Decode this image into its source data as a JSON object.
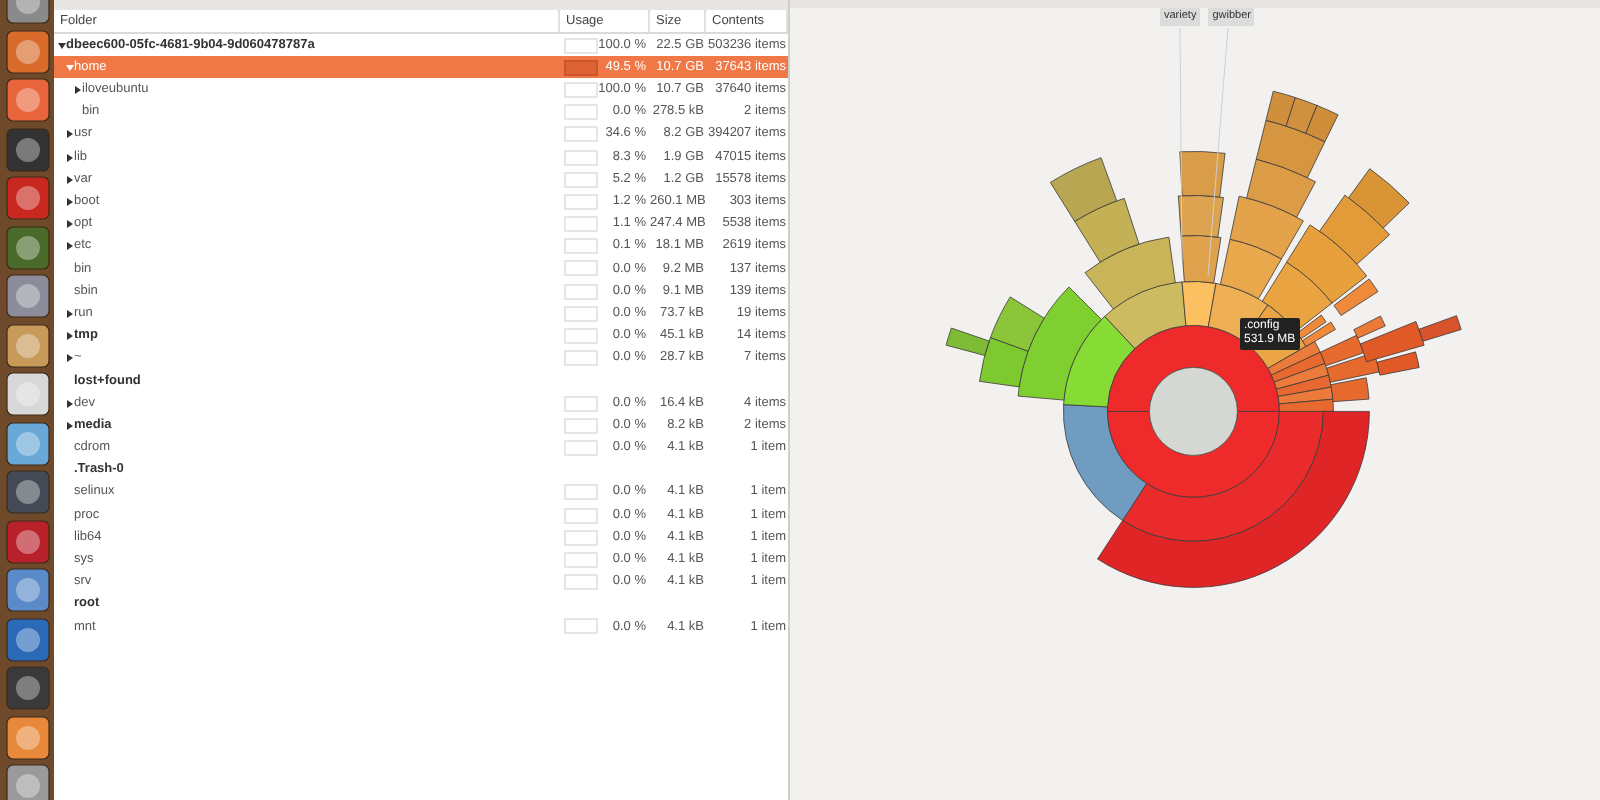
{
  "columns": [
    "Folder",
    "Usage",
    "Size",
    "Contents"
  ],
  "tree": [
    {
      "name": "dbeec600-05fc-4681-9b04-9d060478787a",
      "usage": "100.0 %",
      "size": "22.5 GB",
      "contents": "503236 items",
      "bold": true,
      "expanded": true,
      "selected": false,
      "children": [
        {
          "name": "home",
          "usage": "49.5 %",
          "size": "10.7 GB",
          "contents": "37643 items",
          "bold": false,
          "expanded": true,
          "selected": true,
          "children": [
            {
              "name": "iloveubuntu",
              "usage": "100.0 %",
              "size": "10.7 GB",
              "contents": "37640 items",
              "bold": false,
              "expanded": false,
              "selected": false
            },
            {
              "name": "bin",
              "usage": "0.0 %",
              "size": "278.5 kB",
              "contents": "2 items",
              "bold": false,
              "selected": false
            }
          ]
        },
        {
          "name": "usr",
          "usage": "34.6 %",
          "size": "8.2 GB",
          "contents": "394207 items",
          "bold": false,
          "expanded": false,
          "selected": false
        },
        {
          "name": "lib",
          "usage": "8.3 %",
          "size": "1.9 GB",
          "contents": "47015 items",
          "bold": false,
          "expanded": false,
          "selected": false
        },
        {
          "name": "var",
          "usage": "5.2 %",
          "size": "1.2 GB",
          "contents": "15578 items",
          "bold": false,
          "expanded": false,
          "selected": false
        },
        {
          "name": "boot",
          "usage": "1.2 %",
          "size": "260.1 MB",
          "contents": "303 items",
          "bold": false,
          "expanded": false,
          "selected": false
        },
        {
          "name": "opt",
          "usage": "1.1 %",
          "size": "247.4 MB",
          "contents": "5538 items",
          "bold": false,
          "expanded": false,
          "selected": false
        },
        {
          "name": "etc",
          "usage": "0.1 %",
          "size": "18.1 MB",
          "contents": "2619 items",
          "bold": false,
          "expanded": false,
          "selected": false
        },
        {
          "name": "bin",
          "usage": "0.0 %",
          "size": "9.2 MB",
          "contents": "137 items",
          "bold": false,
          "selected": false
        },
        {
          "name": "sbin",
          "usage": "0.0 %",
          "size": "9.1 MB",
          "contents": "139 items",
          "bold": false,
          "selected": false
        },
        {
          "name": "run",
          "usage": "0.0 %",
          "size": "73.7 kB",
          "contents": "19 items",
          "bold": false,
          "expanded": false,
          "selected": false
        },
        {
          "name": "tmp",
          "usage": "0.0 %",
          "size": "45.1 kB",
          "contents": "14 items",
          "bold": true,
          "expanded": false,
          "selected": false
        },
        {
          "name": "~",
          "usage": "0.0 %",
          "size": "28.7 kB",
          "contents": "7 items",
          "bold": false,
          "expanded": false,
          "selected": false
        },
        {
          "name": "lost+found",
          "bold": true,
          "selected": false
        },
        {
          "name": "dev",
          "usage": "0.0 %",
          "size": "16.4 kB",
          "contents": "4 items",
          "bold": false,
          "expanded": false,
          "selected": false
        },
        {
          "name": "media",
          "usage": "0.0 %",
          "size": "8.2 kB",
          "contents": "2 items",
          "bold": true,
          "expanded": false,
          "selected": false
        },
        {
          "name": "cdrom",
          "usage": "0.0 %",
          "size": "4.1 kB",
          "contents": "1 item",
          "bold": false,
          "selected": false
        },
        {
          "name": ".Trash-0",
          "bold": true,
          "selected": false
        },
        {
          "name": "selinux",
          "usage": "0.0 %",
          "size": "4.1 kB",
          "contents": "1 item",
          "bold": false,
          "selected": false
        },
        {
          "name": "proc",
          "usage": "0.0 %",
          "size": "4.1 kB",
          "contents": "1 item",
          "bold": false,
          "selected": false
        },
        {
          "name": "lib64",
          "usage": "0.0 %",
          "size": "4.1 kB",
          "contents": "1 item",
          "bold": false,
          "selected": false
        },
        {
          "name": "sys",
          "usage": "0.0 %",
          "size": "4.1 kB",
          "contents": "1 item",
          "bold": false,
          "selected": false
        },
        {
          "name": "srv",
          "usage": "0.0 %",
          "size": "4.1 kB",
          "contents": "1 item",
          "bold": false,
          "selected": false
        },
        {
          "name": "root",
          "bold": true,
          "selected": false
        },
        {
          "name": "mnt",
          "usage": "0.0 %",
          "size": "4.1 kB",
          "contents": "1 item",
          "bold": false,
          "selected": false
        }
      ]
    }
  ],
  "chart": {
    "labels": [
      "variety",
      "gwibber"
    ],
    "tooltip": {
      "name": ".config",
      "size": "531.9 MB"
    }
  }
}
